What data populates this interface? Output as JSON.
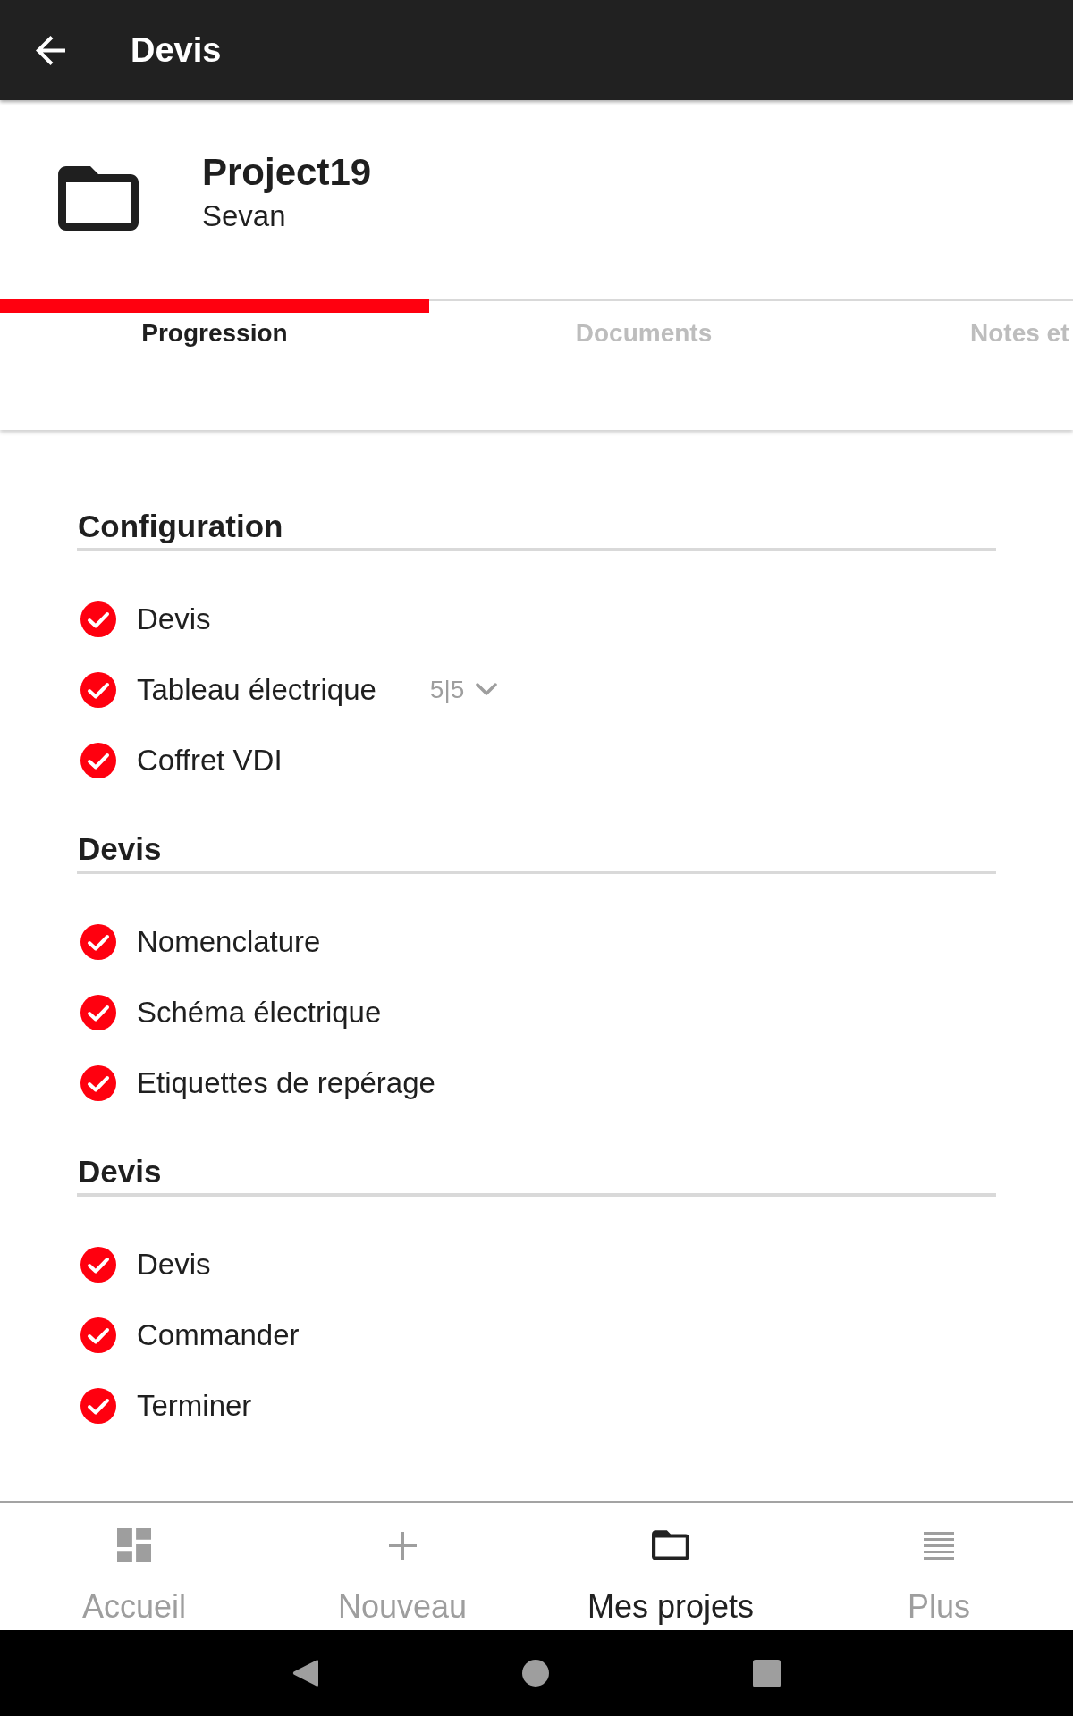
{
  "app_bar": {
    "title": "Devis"
  },
  "project": {
    "name": "Project19",
    "client": "Sevan"
  },
  "tabs": [
    {
      "label": "Progression",
      "selected": true
    },
    {
      "label": "Documents",
      "selected": false
    },
    {
      "label": "Notes et",
      "selected": false
    }
  ],
  "sections": [
    {
      "title": "Configuration",
      "steps": [
        {
          "label": "Devis",
          "checked": true
        },
        {
          "label": "Tableau électrique",
          "checked": true,
          "count": "5|5",
          "expanded": false
        },
        {
          "label": "Coffret VDI",
          "checked": true
        }
      ]
    },
    {
      "title": "Devis",
      "steps": [
        {
          "label": "Nomenclature",
          "checked": true
        },
        {
          "label": "Schéma électrique",
          "checked": true
        },
        {
          "label": "Etiquettes de repérage",
          "checked": true
        }
      ]
    },
    {
      "title": "Devis",
      "steps": [
        {
          "label": "Devis",
          "checked": true
        },
        {
          "label": "Commander",
          "checked": true
        },
        {
          "label": "Terminer",
          "checked": true
        }
      ]
    }
  ],
  "bottom_nav": [
    {
      "label": "Accueil",
      "selected": false
    },
    {
      "label": "Nouveau",
      "selected": false
    },
    {
      "label": "Mes projets",
      "selected": true
    },
    {
      "label": "Plus",
      "selected": false
    }
  ]
}
